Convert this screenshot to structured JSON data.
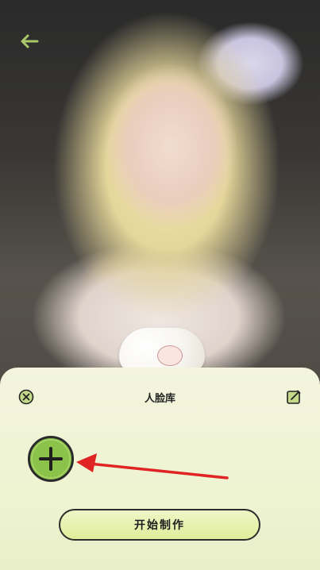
{
  "header": {
    "back_icon": "back-arrow-icon"
  },
  "sheet": {
    "title": "人脸库",
    "close_icon": "close-circle-icon",
    "edit_icon": "edit-square-icon",
    "add_icon": "plus-circle-icon",
    "start_button_label": "开始制作"
  },
  "colors": {
    "sheet_bg": "#eef3d2",
    "accent_green": "#8bc34a",
    "button_bg": "#dfee9a",
    "arrow_red": "#e02424"
  }
}
